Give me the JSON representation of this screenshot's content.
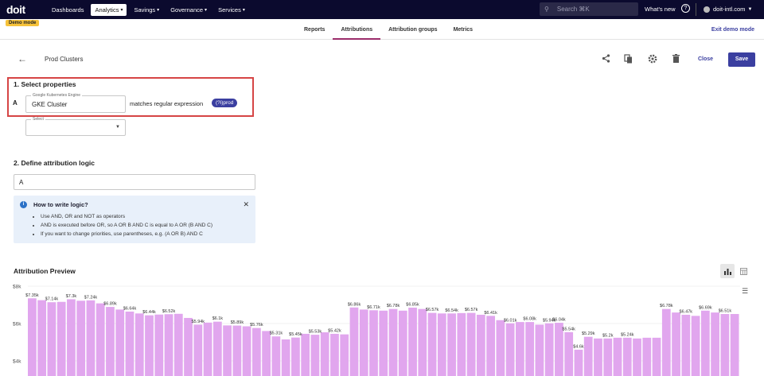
{
  "topbar": {
    "logo": "doit",
    "demo_tag": "Demo mode",
    "nav": [
      {
        "label": "Dashboards",
        "active": false,
        "chevron": false
      },
      {
        "label": "Analytics",
        "active": true,
        "chevron": true
      },
      {
        "label": "Savings",
        "active": false,
        "chevron": true
      },
      {
        "label": "Governance",
        "active": false,
        "chevron": true
      },
      {
        "label": "Services",
        "active": false,
        "chevron": true
      }
    ],
    "search_placeholder": "Search ⌘K",
    "whats_new": "What's new",
    "account": "doit-intl.com"
  },
  "subnav": {
    "tabs": [
      "Reports",
      "Attributions",
      "Attribution groups",
      "Metrics"
    ],
    "active_tab": "Attributions",
    "exit_demo": "Exit demo mode"
  },
  "header": {
    "title": "Prod Clusters",
    "close": "Close",
    "save": "Save"
  },
  "section1": {
    "heading": "1. Select properties",
    "row_letter": "A",
    "field_label": "Google Kubernetes Engine",
    "field_value": "GKE Cluster",
    "operator": "matches regular expression",
    "chip": "(?i)prod",
    "select_label": "Select"
  },
  "section2": {
    "heading": "2. Define attribution logic",
    "logic_value": "A",
    "info_title": "How to write logic?",
    "info_items": [
      "Use AND, OR and NOT as operators",
      "AND is executed before OR, so A OR B AND C is equal to A OR (B AND C)",
      "If you want to change priorities, use parentheses, e.g. (A OR B) AND C"
    ]
  },
  "preview": {
    "heading": "Attribution Preview"
  },
  "chart_data": {
    "type": "bar",
    "y_ticks": [
      "$8k",
      "$6k",
      "$4k"
    ],
    "ylim": [
      4000,
      8000
    ],
    "color": "#e1a6ee",
    "values": [
      7350,
      7250,
      7140,
      7160,
      7300,
      7220,
      7240,
      7080,
      6890,
      6750,
      6640,
      6540,
      6440,
      6480,
      6500,
      6520,
      6300,
      5940,
      6050,
      6100,
      5900,
      5890,
      5850,
      5760,
      5600,
      5310,
      5150,
      5250,
      5450,
      5400,
      5530,
      5450,
      5420,
      6860,
      6750,
      6710,
      6690,
      6780,
      6690,
      6850,
      6780,
      6570,
      6540,
      6540,
      6560,
      6570,
      6470,
      6410,
      6180,
      6010,
      6080,
      6080,
      5940,
      6010,
      6040,
      5540,
      4600,
      5290,
      5200,
      5200,
      5240,
      5240,
      5200,
      5240,
      5240,
      6780,
      6590,
      6470,
      6410,
      6690,
      6590,
      6510,
      6510
    ],
    "labels": [
      {
        "i": 0,
        "text": "$7.35k"
      },
      {
        "i": 2,
        "text": "$7.14k"
      },
      {
        "i": 4,
        "text": "$7.3k"
      },
      {
        "i": 6,
        "text": "$7.24k"
      },
      {
        "i": 8,
        "text": "$6.89k"
      },
      {
        "i": 10,
        "text": "$6.64k"
      },
      {
        "i": 12,
        "text": "$6.44k"
      },
      {
        "i": 14,
        "text": "$6.52k"
      },
      {
        "i": 17,
        "text": "$5.94k"
      },
      {
        "i": 19,
        "text": "$6.1k"
      },
      {
        "i": 21,
        "text": "$5.89k"
      },
      {
        "i": 23,
        "text": "$5.76k"
      },
      {
        "i": 25,
        "text": "$5.31k"
      },
      {
        "i": 27,
        "text": "$5.45k"
      },
      {
        "i": 29,
        "text": "$5.53k"
      },
      {
        "i": 31,
        "text": "$5.42k"
      },
      {
        "i": 33,
        "text": "$6.86k"
      },
      {
        "i": 35,
        "text": "$6.71k"
      },
      {
        "i": 37,
        "text": "$6.78k"
      },
      {
        "i": 39,
        "text": "$6.85k"
      },
      {
        "i": 41,
        "text": "$6.57k"
      },
      {
        "i": 43,
        "text": "$6.54k"
      },
      {
        "i": 45,
        "text": "$6.57k"
      },
      {
        "i": 47,
        "text": "$6.41k"
      },
      {
        "i": 49,
        "text": "$6.01k"
      },
      {
        "i": 51,
        "text": "$6.08k"
      },
      {
        "i": 53,
        "text": "$5.94k"
      },
      {
        "i": 54,
        "text": "$6.04k"
      },
      {
        "i": 55,
        "text": "$5.54k"
      },
      {
        "i": 56,
        "text": "$4.6k"
      },
      {
        "i": 57,
        "text": "$5.29k"
      },
      {
        "i": 59,
        "text": "$5.2k"
      },
      {
        "i": 61,
        "text": "$5.24k"
      },
      {
        "i": 65,
        "text": "$6.78k"
      },
      {
        "i": 67,
        "text": "$6.47k"
      },
      {
        "i": 69,
        "text": "$6.69k"
      },
      {
        "i": 71,
        "text": "$6.51k"
      }
    ]
  }
}
